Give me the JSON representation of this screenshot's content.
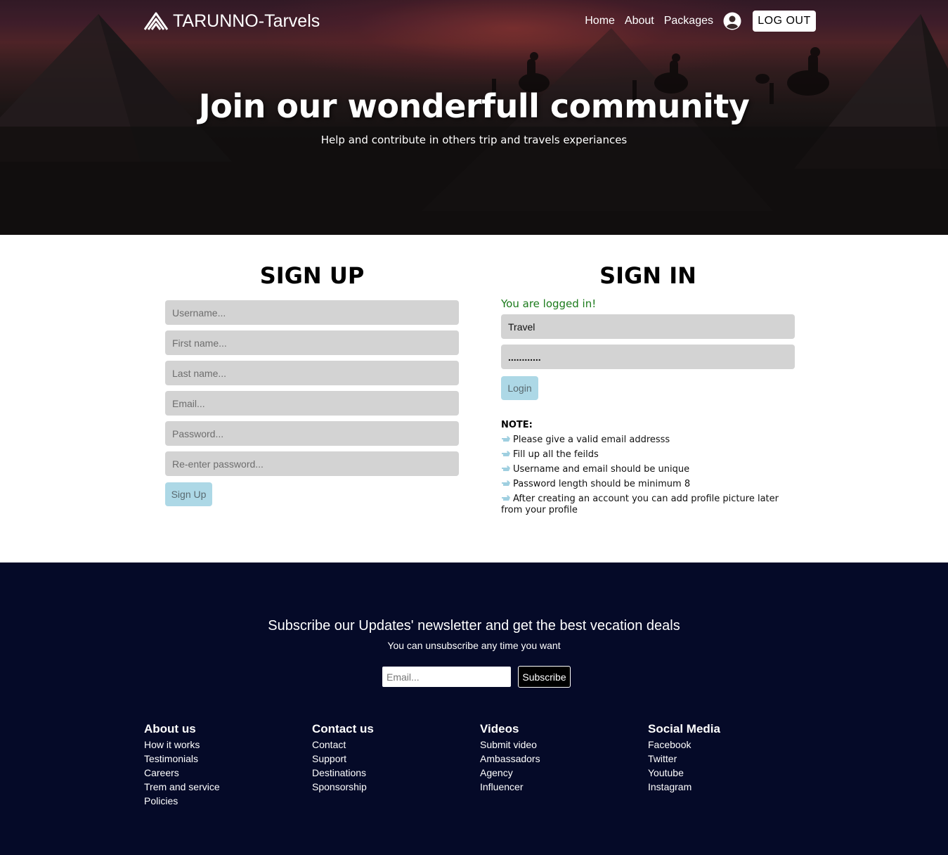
{
  "brand": {
    "name": "TARUNNO-Tarvels"
  },
  "nav": {
    "links": [
      "Home",
      "About",
      "Packages"
    ],
    "logout_label": "LOG OUT"
  },
  "hero": {
    "title": "Join our wonderfull community",
    "subtitle": "Help and contribute in others trip and travels experiances"
  },
  "signup": {
    "title": "SIGN UP",
    "placeholders": [
      "Username...",
      "First name...",
      "Last name...",
      "Email...",
      "Password...",
      "Re-enter password..."
    ],
    "button_label": "Sign Up"
  },
  "signin": {
    "title": "SIGN IN",
    "status_message": "You are logged in!",
    "username_value": "Travel",
    "password_value": "............",
    "button_label": "Login"
  },
  "note": {
    "title": "NOTE:",
    "items": [
      "Please give a valid email addresss",
      "Fill up all the feilds",
      "Username and email should be unique",
      "Password length should be minimum 8",
      "After creating an account you can add profile picture later from your profile"
    ]
  },
  "footer": {
    "newsletter_title": "Subscribe our Updates' newsletter and get the best vecation deals",
    "newsletter_subtitle": "You can unsubscribe any time you want",
    "email_placeholder": "Email...",
    "subscribe_label": "Subscribe",
    "columns": [
      {
        "title": "About us",
        "links": [
          "How it works",
          "Testimonials",
          "Careers",
          "Trem and service",
          "Policies"
        ]
      },
      {
        "title": "Contact us",
        "links": [
          "Contact",
          "Support",
          "Destinations",
          "Sponsorship"
        ]
      },
      {
        "title": "Videos",
        "links": [
          "Submit video",
          "Ambassadors",
          "Agency",
          "Influencer"
        ]
      },
      {
        "title": "Social Media",
        "links": [
          "Facebook",
          "Twitter",
          "Youtube",
          "Instagram"
        ]
      }
    ]
  },
  "colors": {
    "accent_button": "#add8e6",
    "footer_bg": "#050a28",
    "input_bg": "#d3d3d3",
    "success_text": "#1a7a1a"
  }
}
